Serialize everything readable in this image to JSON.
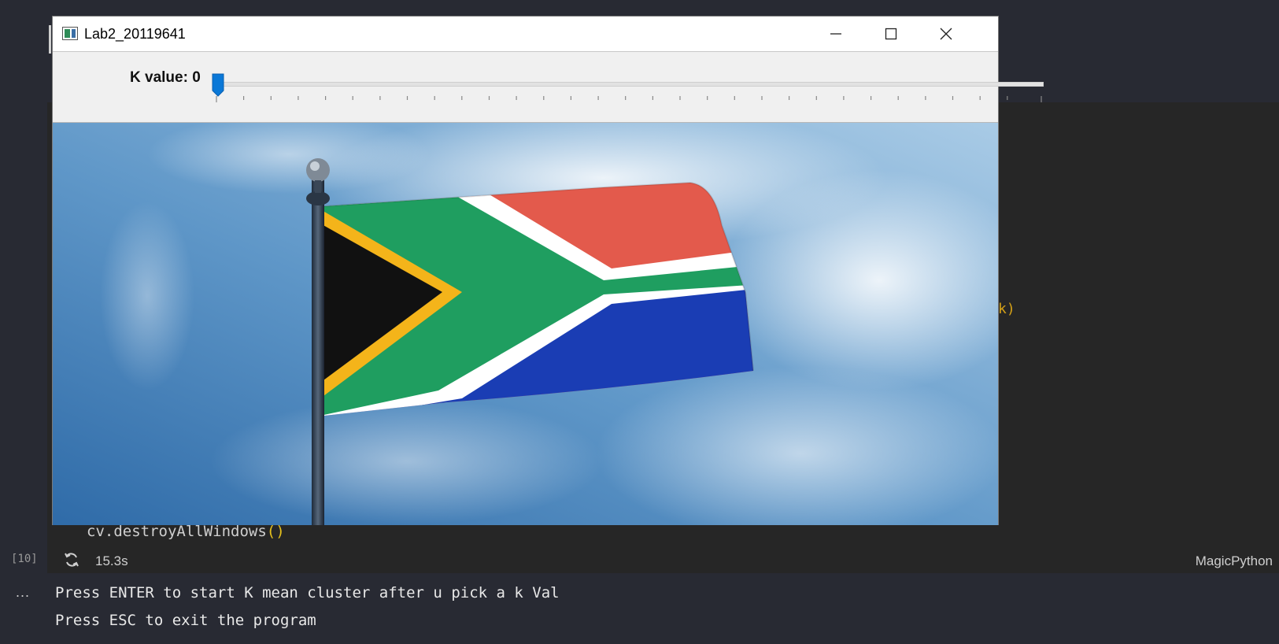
{
  "window": {
    "title": "Lab2_20119641",
    "controls": [
      "minimize-icon",
      "maximize-icon",
      "close-icon"
    ]
  },
  "trackbar": {
    "label": "K value: 0",
    "value": 0
  },
  "image": {
    "subject": "south-africa-flag-on-pole"
  },
  "notebook": {
    "code_line": "cv.destroyAllWindows",
    "code_parens": "()",
    "partial_code": "k)",
    "exec_count": "[10]",
    "exec_time": "15.3s",
    "language": "MagicPython",
    "output_more": "...",
    "output_lines": [
      "Press ENTER to start K mean cluster after u pick a k Val",
      "Press ESC to exit the program"
    ]
  },
  "colors": {
    "editor_bg": "#282a33",
    "cell_bg": "#262626",
    "accent": "#0a78d7",
    "paren": "#e5c01d"
  }
}
